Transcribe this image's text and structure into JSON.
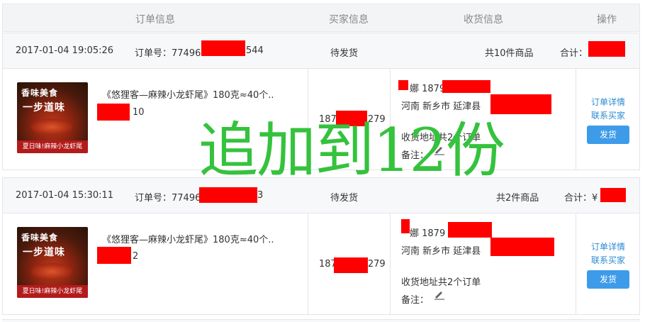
{
  "table_header": {
    "order_info": "订单信息",
    "buyer_info": "买家信息",
    "delivery_info": "收货信息",
    "actions": "操作"
  },
  "orders": [
    {
      "datetime": "2017-01-04 19:05:26",
      "order_no_label": "订单号：",
      "order_no_visible_start": "77496",
      "order_no_visible_end": "544",
      "status": "待发货",
      "items_count": "共10件商品",
      "total_label": "合计：",
      "product": {
        "title": "《悠狸客—麻辣小龙虾尾》180克≈40个..",
        "quantity": "10",
        "image_line1": "香味美食",
        "image_line2": "一步道味",
        "image_caption": "夏日味!麻辣小龙虾尾"
      },
      "buyer_phone_start": "187",
      "buyer_phone_end": "279",
      "recipient": {
        "name_phone": "娜 18790",
        "address": "河南 新乡市 延津县",
        "address_tail": "",
        "address_note": "收货地址共2个订单",
        "remark_label": "备注："
      },
      "actions": {
        "detail": "订单详情",
        "contact": "联系买家",
        "ship": "发货"
      }
    },
    {
      "datetime": "2017-01-04 15:30:11",
      "order_no_label": "订单号：",
      "order_no_visible_start": "77496",
      "order_no_visible_end": "3",
      "status": "待发货",
      "items_count": "共2件商品",
      "total_label": "合计：",
      "total_prefix": "¥",
      "product": {
        "title": "《悠狸客—麻辣小龙虾尾》180克≈40个..",
        "quantity": "2",
        "image_line1": "香味美食",
        "image_line2": "一步道味",
        "image_caption": "夏日味!麻辣小龙虾尾"
      },
      "buyer_phone_start": "187",
      "buyer_phone_end": "279",
      "recipient": {
        "name_phone": "娜 1879",
        "address": "河南 新乡市 延津县",
        "address_tail": "",
        "address_note": "收货地址共2个订单",
        "remark_label": "备注："
      },
      "actions": {
        "detail": "订单详情",
        "contact": "联系买家",
        "ship": "发货"
      }
    }
  ],
  "overlay_text": "追加到12份",
  "colors": {
    "redaction": "#ff0000",
    "link": "#2a8ad4",
    "button": "#3d9be9",
    "overlay": "#35c23d"
  }
}
